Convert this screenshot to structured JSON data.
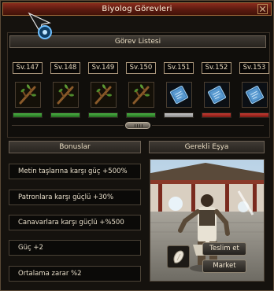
{
  "window": {
    "title": "Biyolog Görevleri"
  },
  "mission_list": {
    "header": "Görev Listesi",
    "levels": [
      "Sv.147",
      "Sv.148",
      "Sv.149",
      "Sv.150",
      "Sv.151",
      "Sv.152",
      "Sv.153"
    ],
    "item_icons": [
      "branch-icon",
      "branch-icon",
      "branch-icon",
      "branch-icon",
      "book-icon",
      "book-icon",
      "book-icon"
    ],
    "status_colors": [
      "green",
      "green",
      "green",
      "green",
      "gray",
      "red",
      "red"
    ]
  },
  "bonuses": {
    "header": "Bonuslar",
    "items": [
      "Metin taşlarına karşı güç +500%",
      "Patronlara karşı güçlü +30%",
      "Canavarlara karşı güçlü +%500",
      "Güç +2",
      "Ortalama zarar %2"
    ]
  },
  "required_item": {
    "header": "Gerekli Eşya",
    "deliver_label": "Teslim et",
    "market_label": "Market"
  },
  "colors": {
    "title_bar": "#6a2014",
    "status_green": "#3d9a36",
    "status_gray": "#a8a8a8",
    "status_red": "#b0302a"
  }
}
